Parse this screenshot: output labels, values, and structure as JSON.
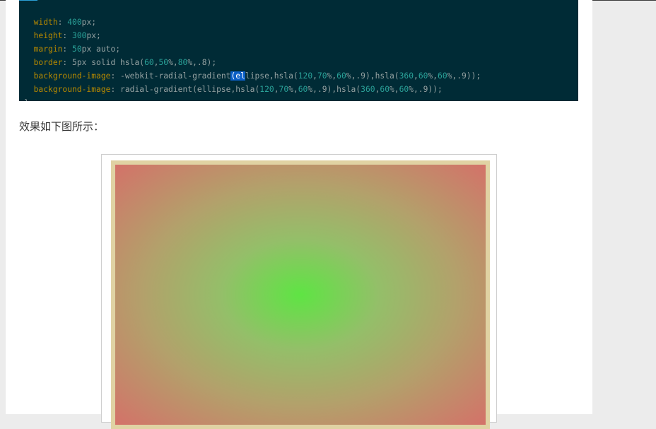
{
  "code": {
    "lines": [
      {
        "prop": "width",
        "rest": [
          {
            "t": "num",
            "v": "400"
          },
          {
            "t": "plain",
            "v": "px;"
          }
        ]
      },
      {
        "prop": "height",
        "rest": [
          {
            "t": "num",
            "v": "300"
          },
          {
            "t": "plain",
            "v": "px;"
          }
        ]
      },
      {
        "prop": "margin",
        "rest": [
          {
            "t": "num",
            "v": "50"
          },
          {
            "t": "plain",
            "v": "px auto;"
          }
        ]
      },
      {
        "prop": "border",
        "rest": [
          {
            "t": "plain",
            "v": "5px solid hsla("
          },
          {
            "t": "num",
            "v": "60"
          },
          {
            "t": "plain",
            "v": ","
          },
          {
            "t": "num",
            "v": "50"
          },
          {
            "t": "plain",
            "v": "%,"
          },
          {
            "t": "num",
            "v": "80"
          },
          {
            "t": "plain",
            "v": "%,.8);"
          }
        ]
      },
      {
        "prop": "background-image",
        "rest": [
          {
            "t": "plain",
            "v": "-webkit-radial-gradient"
          },
          {
            "t": "sel",
            "v": "(el"
          },
          {
            "t": "plain",
            "v": "lipse,hsla("
          },
          {
            "t": "num",
            "v": "120"
          },
          {
            "t": "plain",
            "v": ","
          },
          {
            "t": "num",
            "v": "70"
          },
          {
            "t": "plain",
            "v": "%,"
          },
          {
            "t": "num",
            "v": "60"
          },
          {
            "t": "plain",
            "v": "%,.9),hsla("
          },
          {
            "t": "num",
            "v": "360"
          },
          {
            "t": "plain",
            "v": ","
          },
          {
            "t": "num",
            "v": "60"
          },
          {
            "t": "plain",
            "v": "%,"
          },
          {
            "t": "num",
            "v": "60"
          },
          {
            "t": "plain",
            "v": "%,.9));"
          }
        ]
      },
      {
        "prop": "background-image",
        "rest": [
          {
            "t": "plain",
            "v": "radial-gradient(ellipse,hsla("
          },
          {
            "t": "num",
            "v": "120"
          },
          {
            "t": "plain",
            "v": ","
          },
          {
            "t": "num",
            "v": "70"
          },
          {
            "t": "plain",
            "v": "%,"
          },
          {
            "t": "num",
            "v": "60"
          },
          {
            "t": "plain",
            "v": "%,.9),hsla("
          },
          {
            "t": "num",
            "v": "360"
          },
          {
            "t": "plain",
            "v": ","
          },
          {
            "t": "num",
            "v": "60"
          },
          {
            "t": "plain",
            "v": "%,"
          },
          {
            "t": "num",
            "v": "60"
          },
          {
            "t": "plain",
            "v": "%,.9));"
          }
        ]
      }
    ],
    "closing_brace": "}"
  },
  "caption": "效果如下图所示：",
  "colors": {
    "code_bg": "#002b36",
    "property": "#b58900",
    "number": "#2aa198",
    "selection": "#0b5fc6"
  }
}
